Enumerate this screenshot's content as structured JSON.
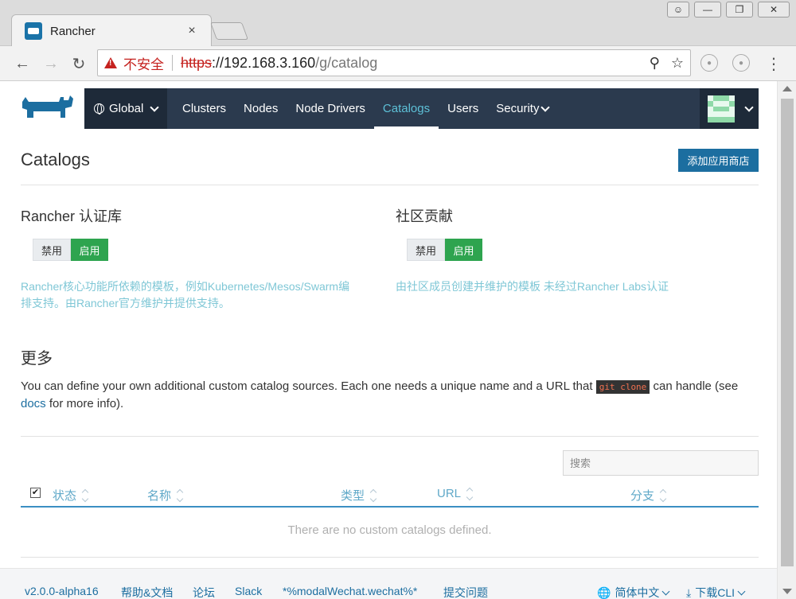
{
  "browser": {
    "tab_title": "Rancher",
    "tab_close": "×",
    "insecure_label": "不安全",
    "url_scheme": "https",
    "url_host": "://192.168.3.160",
    "url_path": "/g/catalog"
  },
  "nav": {
    "global_label": "Global",
    "items": [
      "Clusters",
      "Nodes",
      "Node Drivers",
      "Catalogs",
      "Users",
      "Security"
    ],
    "active": "Catalogs"
  },
  "page": {
    "title": "Catalogs",
    "add_button": "添加应用商店"
  },
  "library": {
    "title": "Rancher 认证库",
    "off_label": "禁用",
    "on_label": "启用",
    "state": "enabled",
    "desc_line1": "Rancher核心功能所依赖的模板，例如Kubernetes/Mesos/Swarm编",
    "desc_line2": "排支持。由Rancher官方维护并提供支持。"
  },
  "community": {
    "title": "社区贡献",
    "off_label": "禁用",
    "on_label": "启用",
    "state": "enabled",
    "desc": "由社区成员创建并维护的模板 未经过Rancher Labs认证"
  },
  "more": {
    "title": "更多",
    "text_before": "You can define your own additional custom catalog sources. Each one needs a unique name and a URL that ",
    "code": "git clone",
    "text_middle": " can handle (see ",
    "link": "docs",
    "text_after": " for more info)."
  },
  "table": {
    "search_placeholder": "搜索",
    "columns": [
      "状态",
      "名称",
      "类型",
      "URL",
      "分支"
    ],
    "empty_text": "There are no custom catalogs defined."
  },
  "footer": {
    "version": "v2.0.0-alpha16",
    "help": "帮助&文档",
    "forum": "论坛",
    "slack": "Slack",
    "wechat": "*%modalWechat.wechat%*",
    "issue": "提交问题",
    "language": "简体中文",
    "download": "下载CLI"
  },
  "colors": {
    "nav_bg": "#2b3a4e",
    "nav_active": "#5dc0d7",
    "primary": "#1c6ea0",
    "success": "#2ea44f",
    "desc_text": "#7fc7d6"
  }
}
